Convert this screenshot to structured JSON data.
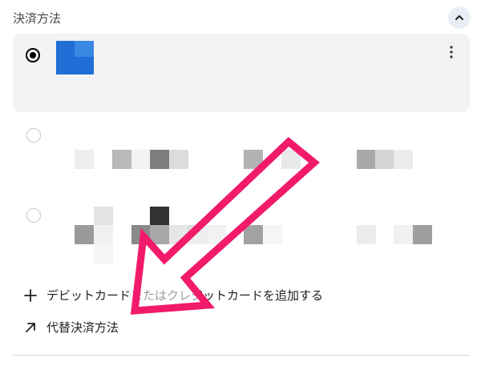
{
  "section": {
    "title": "決済方法"
  },
  "icons": {
    "collapse": "chevron-up-icon",
    "more": "more-vert-icon",
    "add": "plus-icon",
    "alternate": "arrow-up-right-icon",
    "annotation": "arrow-annotation"
  },
  "colors": {
    "arrow": "#f21a6b",
    "logo": "#1f6fd6",
    "card_bg": "#f3f3f3"
  },
  "actions": {
    "add_card_label": "デビットカードまたはクレジットカードを追加する",
    "alternate_label": "代替決済方法"
  }
}
